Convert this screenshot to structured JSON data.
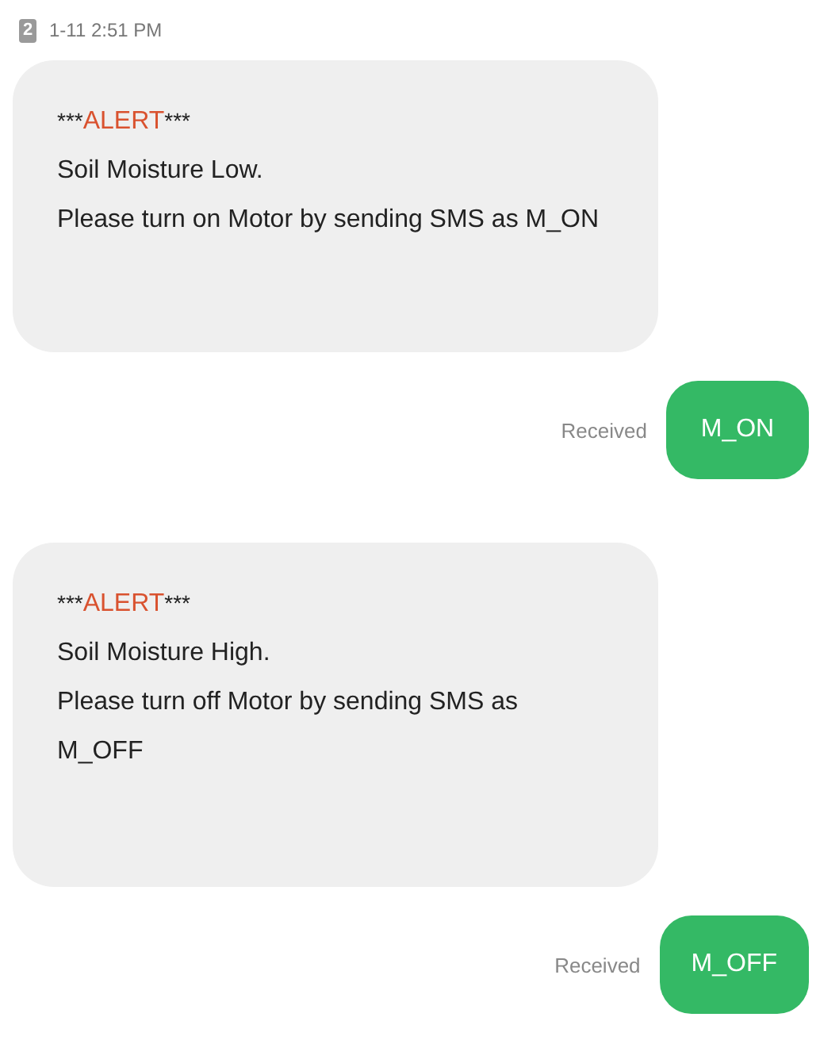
{
  "header": {
    "sim": "2",
    "time": "1-11 2:51 PM"
  },
  "messages": [
    {
      "kind": "incoming",
      "alert": {
        "before": "***",
        "word": "ALERT",
        "after": "***"
      },
      "lines": [
        "Soil Moisture Low.",
        "Please turn on Motor by sending SMS as M_ON"
      ]
    },
    {
      "kind": "outgoing",
      "status": "Received",
      "text": "M_ON"
    },
    {
      "kind": "incoming",
      "alert": {
        "before": "***",
        "word": "ALERT",
        "after": "***"
      },
      "lines": [
        "Soil Moisture High.",
        "Please turn off Motor by sending SMS as",
        "M_OFF"
      ]
    },
    {
      "kind": "outgoing",
      "status": "Received",
      "text": "M_OFF"
    }
  ]
}
